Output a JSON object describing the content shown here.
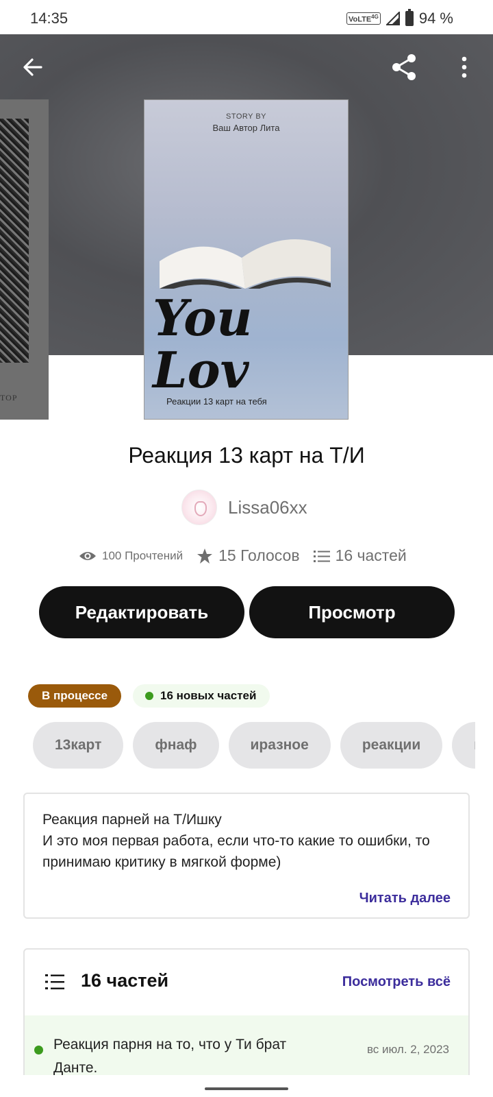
{
  "status_bar": {
    "time": "14:35",
    "network": "VoLTE",
    "network_gen": "4G",
    "battery": "94 %"
  },
  "toolbar": {
    "back_icon": "arrow-left-icon",
    "share_icon": "share-icon",
    "more_icon": "more-vertical-icon"
  },
  "cover": {
    "story_by": "STORY BY",
    "author": "Ваш Автор Лита",
    "title_line1": "You",
    "title_line2": "Lov",
    "subtitle": "Реакции 13 карт на тебя",
    "side_caption": "ТОР"
  },
  "story": {
    "title": "Реакция 13 карт на Т/И",
    "author": "Lissa06xx"
  },
  "stats": {
    "reads": "100 Прочтений",
    "votes": "15 Голосов",
    "parts": "16 частей"
  },
  "actions": {
    "edit": "Редактировать",
    "view": "Просмотр"
  },
  "status": {
    "progress": "В процессе",
    "new_parts": "16 новых частей"
  },
  "tags": [
    "13карт",
    "фнаф",
    "иразное",
    "реакции",
    "к"
  ],
  "description": {
    "text": "Реакция парней на Т/Ишку\nИ это моя первая работа, если что-то какие то ошибки, то принимаю критику в мягкой форме)",
    "read_more": "Читать далее"
  },
  "parts": {
    "count_label": "16 частей",
    "see_all": "Посмотреть всё",
    "items": [
      {
        "title": "Реакция парня на то, что у Ти брат Данте.",
        "date": "вс июл. 2, 2023"
      }
    ]
  },
  "colors": {
    "primary_button": "#121212",
    "progress_badge": "#9a5a0b",
    "new_dot": "#3c9b1e",
    "link": "#3c2d9c",
    "tag_bg": "#e5e5e7"
  }
}
